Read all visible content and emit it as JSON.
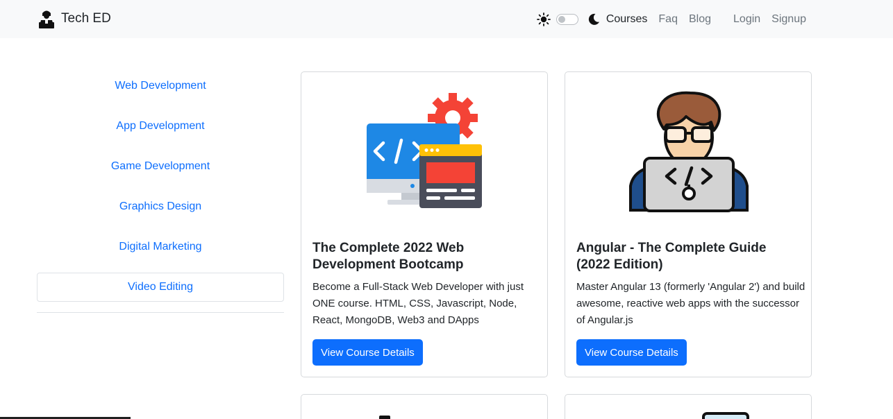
{
  "navbar": {
    "brand": "Tech ED",
    "links": [
      {
        "label": "Courses"
      },
      {
        "label": "Faq"
      },
      {
        "label": "Blog"
      },
      {
        "label": "Login"
      },
      {
        "label": "Signup"
      }
    ]
  },
  "sidebar": {
    "items": [
      {
        "label": "Web Development"
      },
      {
        "label": "App Development"
      },
      {
        "label": "Game Development"
      },
      {
        "label": "Graphics Design"
      },
      {
        "label": "Digital Marketing"
      },
      {
        "label": "Video Editing"
      }
    ]
  },
  "courses": [
    {
      "title": "The Complete 2022 Web Development Bootcamp",
      "description": "Become a Full-Stack Web Developer with just ONE course. HTML, CSS, Javascript, Node, React, MongoDB, Web3 and DApps",
      "button": "View Course Details",
      "icon": "web-development-icon"
    },
    {
      "title": "Angular - The Complete Guide (2022 Edition)",
      "description": "Master Angular 13 (formerly 'Angular 2') and build awesome, reactive web apps with the successor of Angular.js",
      "button": "View Course Details",
      "icon": "developer-icon"
    }
  ],
  "colors": {
    "primary": "#0d6efd",
    "navbar_bg": "#f8f9fa",
    "muted_link": "#6c757d"
  }
}
